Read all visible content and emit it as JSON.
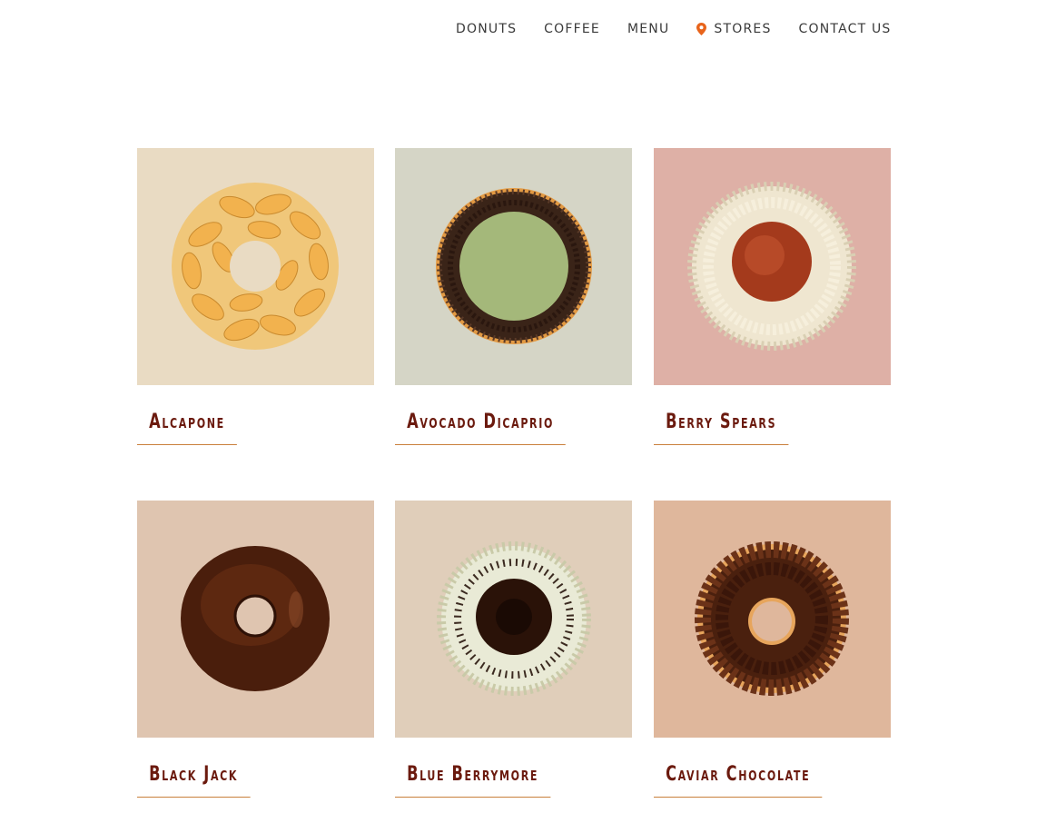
{
  "nav": {
    "items": [
      {
        "label": "DONUTS"
      },
      {
        "label": "COFFEE"
      },
      {
        "label": "MENU"
      },
      {
        "label": "STORES",
        "icon": "map-pin-icon"
      },
      {
        "label": "CONTACT US"
      }
    ],
    "accent": "#e8641b"
  },
  "products": [
    {
      "name": "Alcapone",
      "bg": "#e9dbc3"
    },
    {
      "name": "Avocado Dicaprio",
      "bg": "#d5d5c6"
    },
    {
      "name": "Berry Spears",
      "bg": "#deb0a6"
    },
    {
      "name": "Black Jack",
      "bg": "#dfc5b0"
    },
    {
      "name": "Blue Berrymore",
      "bg": "#e0ceba"
    },
    {
      "name": "Caviar Chocolate",
      "bg": "#dfb79c"
    }
  ],
  "colors": {
    "title": "#6b1a0e",
    "underline": "#c9803c",
    "nav_text": "#3a3a3a"
  }
}
